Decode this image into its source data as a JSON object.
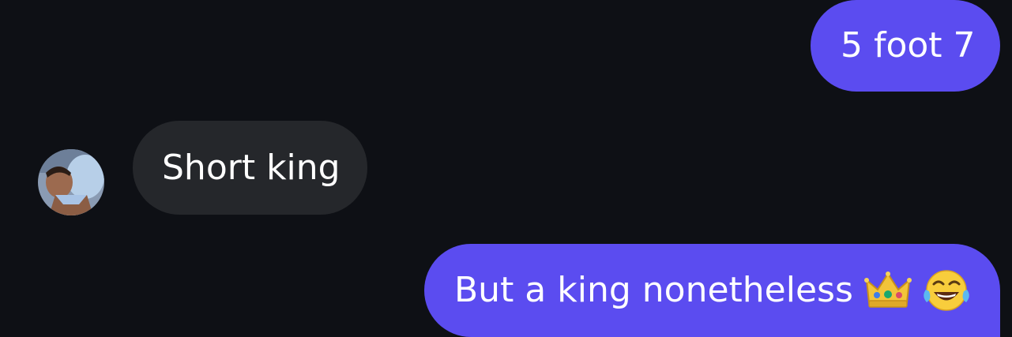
{
  "conversation": {
    "messages": [
      {
        "sender": "me",
        "text": "5 foot 7"
      },
      {
        "sender": "contact",
        "text": "Short king"
      },
      {
        "sender": "me",
        "text": "But a king nonetheless",
        "emojis": [
          "crown-icon",
          "face-with-tears-of-joy-icon"
        ]
      }
    ]
  },
  "colors": {
    "background": "#0e1015",
    "sent_bubble": "#5b4cf0",
    "received_bubble": "#25272b",
    "text": "#ffffff"
  }
}
